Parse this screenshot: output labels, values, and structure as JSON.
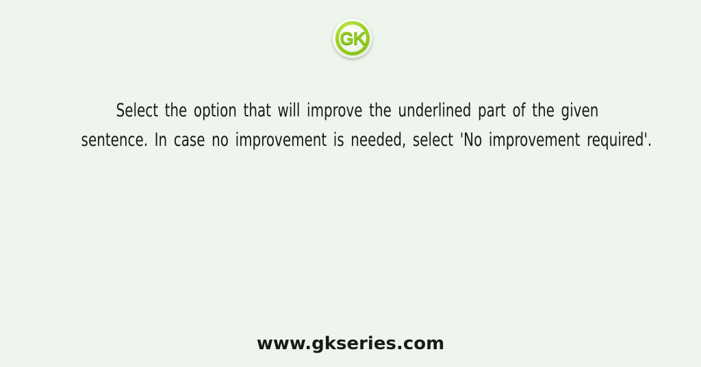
{
  "logo": {
    "text": "GK",
    "icon": "gk-logo-icon",
    "colors": {
      "ring": "#9fd424",
      "text": "#8fcb1a"
    }
  },
  "question": {
    "lines": [
      "Select the option that will improve the underlined part of the given",
      "sentence. In case no improvement is needed, select 'No improvement required'."
    ]
  },
  "footer": {
    "website": "www.gkseries.com"
  },
  "colors": {
    "background": "#eef5ec",
    "text": "#1a1a1a"
  }
}
